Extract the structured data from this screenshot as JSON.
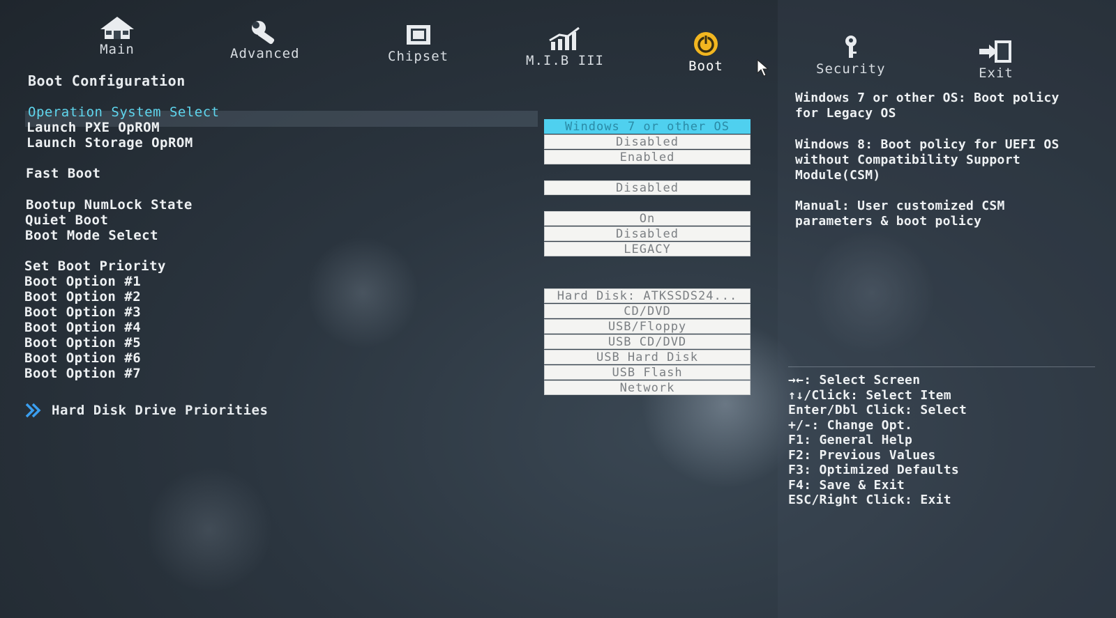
{
  "nav": {
    "tabs": [
      {
        "label": "Main",
        "icon": "home-icon"
      },
      {
        "label": "Advanced",
        "icon": "wrench-icon"
      },
      {
        "label": "Chipset",
        "icon": "chip-icon"
      },
      {
        "label": "M.I.B III",
        "icon": "chart-icon"
      },
      {
        "label": "Boot",
        "icon": "power-icon",
        "active": true
      },
      {
        "label": "Security",
        "icon": "key-icon"
      },
      {
        "label": "Exit",
        "icon": "exit-icon"
      }
    ]
  },
  "section_title": "Boot Configuration",
  "settings": [
    {
      "label": "Operation System Select",
      "selected": true
    },
    {
      "label": "Launch PXE OpROM"
    },
    {
      "label": "Launch Storage OpROM"
    },
    {
      "label": "Fast Boot"
    },
    {
      "label": "Bootup NumLock State"
    },
    {
      "label": "Quiet Boot"
    },
    {
      "label": "Boot Mode Select"
    },
    {
      "label": "Set Boot Priority"
    },
    {
      "label": "Boot Option #1"
    },
    {
      "label": "Boot Option #2"
    },
    {
      "label": "Boot Option #3"
    },
    {
      "label": "Boot Option #4"
    },
    {
      "label": "Boot Option #5"
    },
    {
      "label": "Boot Option #6"
    },
    {
      "label": "Boot Option #7"
    }
  ],
  "values": [
    {
      "text": "Windows 7 or other OS",
      "highlighted": true
    },
    {
      "text": "Disabled"
    },
    {
      "text": "Enabled"
    },
    {
      "text": "Disabled"
    },
    {
      "text": "On"
    },
    {
      "text": "Disabled"
    },
    {
      "text": "LEGACY"
    },
    {
      "text": "Hard Disk: ATKSSDS24..."
    },
    {
      "text": "CD/DVD"
    },
    {
      "text": "USB/Floppy"
    },
    {
      "text": "USB CD/DVD"
    },
    {
      "text": "USB Hard Disk"
    },
    {
      "text": "USB Flash"
    },
    {
      "text": "Network"
    }
  ],
  "submenu": {
    "label": "Hard Disk Drive Priorities",
    "icon": "double-chevron-right-icon"
  },
  "help": {
    "p1": "Windows 7 or other OS: Boot policy\nfor Legacy OS",
    "p2": "Windows 8: Boot policy for UEFI OS\nwithout Compatibility Support\nModule(CSM)",
    "p3": "Manual: User customized CSM\nparameters & boot policy"
  },
  "keys": [
    "→←: Select Screen",
    "↑↓/Click: Select Item",
    "Enter/Dbl Click: Select",
    "+/-: Change Opt.",
    "F1: General Help",
    "F2: Previous Values",
    "F3: Optimized Defaults",
    "F4: Save & Exit",
    "ESC/Right Click: Exit"
  ],
  "colors": {
    "accent": "#4fd0ef",
    "active_tab_icon": "#f2b620",
    "background": "#2b353f"
  }
}
